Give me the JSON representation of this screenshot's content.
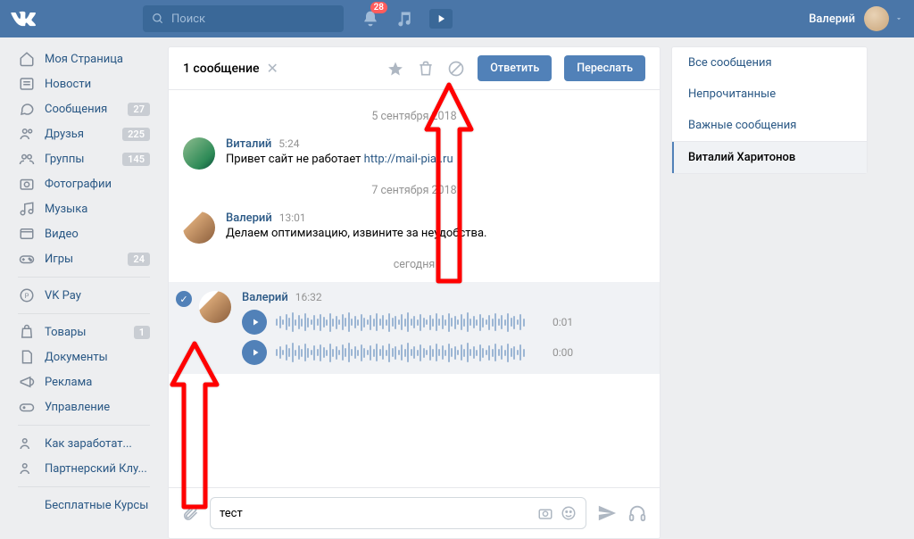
{
  "header": {
    "search_placeholder": "Поиск",
    "notification_count": "28",
    "user_name": "Валерий"
  },
  "sidebar": {
    "items": [
      {
        "icon": "home",
        "label": "Моя Страница",
        "count": ""
      },
      {
        "icon": "news",
        "label": "Новости",
        "count": ""
      },
      {
        "icon": "msg",
        "label": "Сообщения",
        "count": "27"
      },
      {
        "icon": "friends",
        "label": "Друзья",
        "count": "225"
      },
      {
        "icon": "groups",
        "label": "Группы",
        "count": "145"
      },
      {
        "icon": "photo",
        "label": "Фотографии",
        "count": ""
      },
      {
        "icon": "music",
        "label": "Музыка",
        "count": ""
      },
      {
        "icon": "video",
        "label": "Видео",
        "count": ""
      },
      {
        "icon": "game",
        "label": "Игры",
        "count": "24"
      }
    ],
    "vkpay": "VK Pay",
    "items2": [
      {
        "icon": "bag",
        "label": "Товары",
        "count": "1"
      },
      {
        "icon": "doc",
        "label": "Документы",
        "count": ""
      },
      {
        "icon": "ad",
        "label": "Реклама",
        "count": ""
      },
      {
        "icon": "manage",
        "label": "Управление",
        "count": ""
      }
    ],
    "items3": [
      {
        "icon": "friends",
        "label": "Как заработат...",
        "count": ""
      },
      {
        "icon": "friends",
        "label": "Партнерский Клу...",
        "count": ""
      }
    ],
    "items4_label": "Бесплатные Курсы"
  },
  "chat": {
    "selection_text": "1 сообщение",
    "reply_label": "Ответить",
    "forward_label": "Переслать",
    "date1": "5 сентября 2018",
    "date2": "7 сентября 2018",
    "date3": "сегодня",
    "msg1": {
      "name": "Виталий",
      "time": "5:24",
      "text_prefix": "Привет сайт не работает ",
      "link": "http://mail-piar.ru"
    },
    "msg2": {
      "name": "Валерий",
      "time": "13:01",
      "text": "Делаем оптимизацию, извините за неудобства."
    },
    "msg3": {
      "name": "Валерий",
      "time": "16:32",
      "audio1_dur": "0:01",
      "audio2_dur": "0:00"
    },
    "input_value": "тест"
  },
  "right": {
    "all": "Все сообщения",
    "unread": "Непрочитанные",
    "important": "Важные сообщения",
    "active": "Виталий Харитонов"
  }
}
